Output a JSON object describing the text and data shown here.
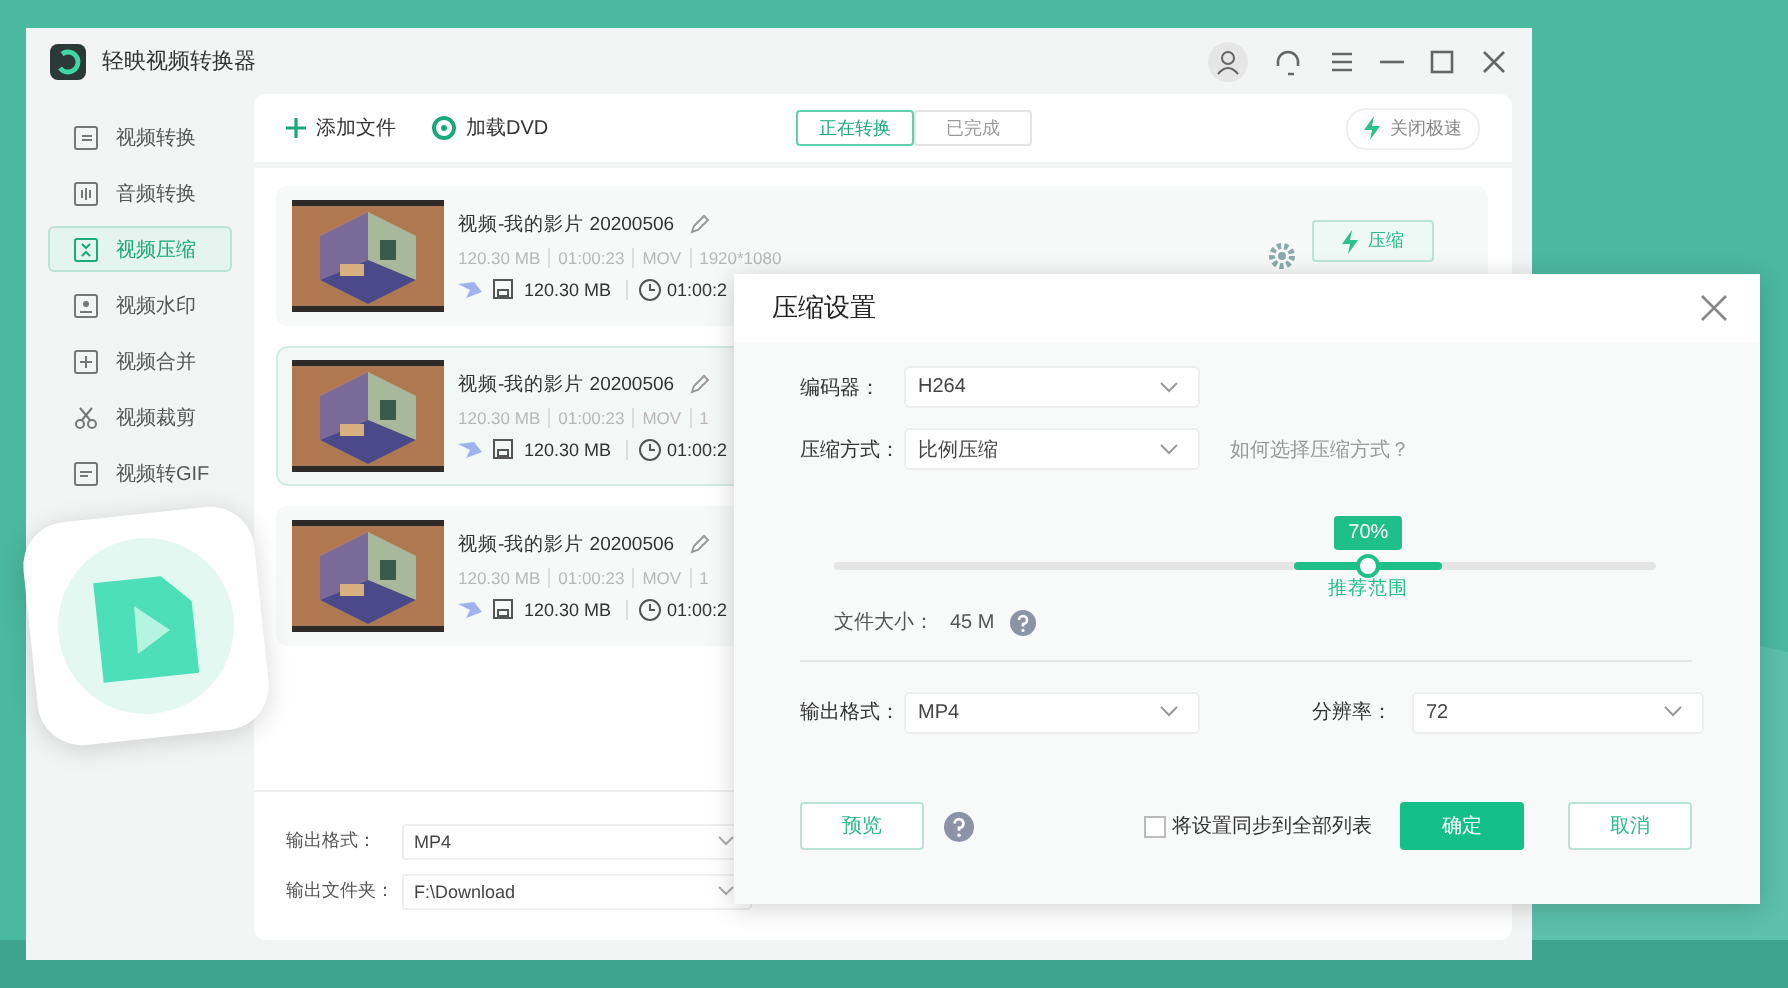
{
  "window": {
    "title": "轻映视频转换器"
  },
  "sidebar": {
    "items": [
      {
        "label": "视频转换",
        "kind": "convert",
        "selected": false
      },
      {
        "label": "音频转换",
        "kind": "audio",
        "selected": false
      },
      {
        "label": "视频压缩",
        "kind": "compress",
        "selected": true
      },
      {
        "label": "视频水印",
        "kind": "watermark",
        "selected": false
      },
      {
        "label": "视频合并",
        "kind": "merge",
        "selected": false
      },
      {
        "label": "视频裁剪",
        "kind": "cut",
        "selected": false
      },
      {
        "label": "视频转GIF",
        "kind": "gif",
        "selected": false
      }
    ]
  },
  "toolbar": {
    "actions": [
      {
        "label": "添加文件",
        "kind": "add"
      },
      {
        "label": "加载DVD",
        "kind": "dvd"
      }
    ],
    "tabs": [
      {
        "label": "正在转换",
        "selected": true
      },
      {
        "label": "已完成",
        "selected": false
      }
    ],
    "speed_button": "关闭极速"
  },
  "files": [
    {
      "name": "视频-我的影片 20200506",
      "meta": [
        "120.30 MB",
        "01:00:23",
        "MOV",
        "1920*1080"
      ],
      "output_size": "120.30 MB",
      "output_duration": "01:00:2",
      "selected": false,
      "action": "压缩"
    },
    {
      "name": "视频-我的影片 20200506",
      "meta": [
        "120.30 MB",
        "01:00:23",
        "MOV",
        "1"
      ],
      "output_size": "120.30 MB",
      "output_duration": "01:00:2",
      "selected": true
    },
    {
      "name": "视频-我的影片 20200506",
      "meta": [
        "120.30 MB",
        "01:00:23",
        "MOV",
        "1"
      ],
      "output_size": "120.30 MB",
      "output_duration": "01:00:2",
      "selected": false
    }
  ],
  "output": {
    "format_label": "输出格式：",
    "format": "MP4",
    "folder_label": "输出文件夹：",
    "folder": "F:\\Download"
  },
  "dialog": {
    "title": "压缩设置",
    "fields": [
      {
        "label": "编码器：",
        "value": "H264"
      },
      {
        "label": "压缩方式：",
        "value": "比例压缩",
        "help_link": "如何选择压缩方式？"
      }
    ],
    "slider": {
      "level": 0.65,
      "reading": "70%",
      "range_label": "推荐范围"
    },
    "file_size_label": "文件大小：",
    "file_size": "45 M",
    "output_format": {
      "label": "输出格式：",
      "value": "MP4"
    },
    "resolution": {
      "label": "分辨率：",
      "value": "72"
    },
    "preview_button": "预览",
    "sync_checkbox": {
      "label": "将设置同步到全部列表",
      "checked": false
    },
    "buttons": [
      {
        "label": "确定",
        "kind": "primary"
      },
      {
        "label": "取消",
        "kind": "secondary"
      }
    ]
  }
}
